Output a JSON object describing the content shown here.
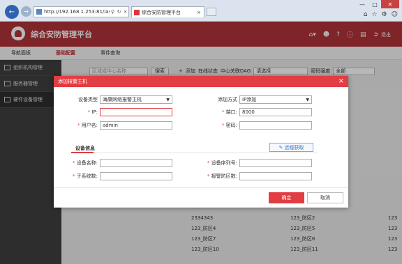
{
  "browser": {
    "url": "http://192.168.1.253:81/ias/hc",
    "url_icons": [
      "search-icon",
      "refresh-icon",
      "close-icon"
    ],
    "tab_title": "综合安防管理平台",
    "tab_close": "×",
    "win_controls": [
      "—",
      "□",
      "✕"
    ],
    "right_icons": [
      "home-icon",
      "star-icon",
      "gear-icon",
      "smiley-icon"
    ]
  },
  "app": {
    "title": "综合安防管理平台",
    "header_icons": [
      "home-icon",
      "user-icon",
      "help-icon",
      "info-icon",
      "clipboard-icon",
      "exit-icon"
    ],
    "exit_label": "退出"
  },
  "top_nav": [
    {
      "label": "导航面板",
      "active": false
    },
    {
      "label": "基础配置",
      "active": true
    },
    {
      "label": "事件查询",
      "active": false
    }
  ],
  "sidebar": [
    {
      "label": "组织机构管理",
      "active": false
    },
    {
      "label": "服务器管理",
      "active": false
    },
    {
      "label": "硬件设备管理",
      "active": true
    }
  ],
  "content": {
    "search_placeholder": "区域或中心名称",
    "search_button": "搜索",
    "add_button": "添加",
    "online_status": "在线状态",
    "center_dag_label": "中心关联DAG",
    "center_dag_value": "请选择",
    "pwd_strength_label": "密码强度",
    "pwd_strength_value": "全部",
    "list_col1": [
      "2334343",
      "123_防区4",
      "123_防区7",
      "123_防区10"
    ],
    "list_col2": [
      "123_防区2",
      "123_防区5",
      "123_防区8",
      "123_防区11"
    ],
    "list_col3": [
      "123",
      "123",
      "123",
      "123"
    ]
  },
  "modal": {
    "title": "添加报警主机",
    "device_type_label": "设备类型",
    "device_type_value": "海康网络报警主机",
    "add_method_label": "添加方式",
    "add_method_value": "IP添加",
    "ip_label": "IP",
    "ip_value": "",
    "port_label": "端口",
    "port_value": "8000",
    "username_label": "用户名",
    "username_value": "admin",
    "password_label": "密码",
    "password_value": "",
    "section_title": "设备信息",
    "remote_button": "远程获取",
    "device_name_label": "设备名称",
    "device_serial_label": "设备序列号",
    "subsystem_count_label": "子系统数",
    "zone_count_label": "报警防区数",
    "confirm_button": "确定",
    "cancel_button": "取消"
  }
}
